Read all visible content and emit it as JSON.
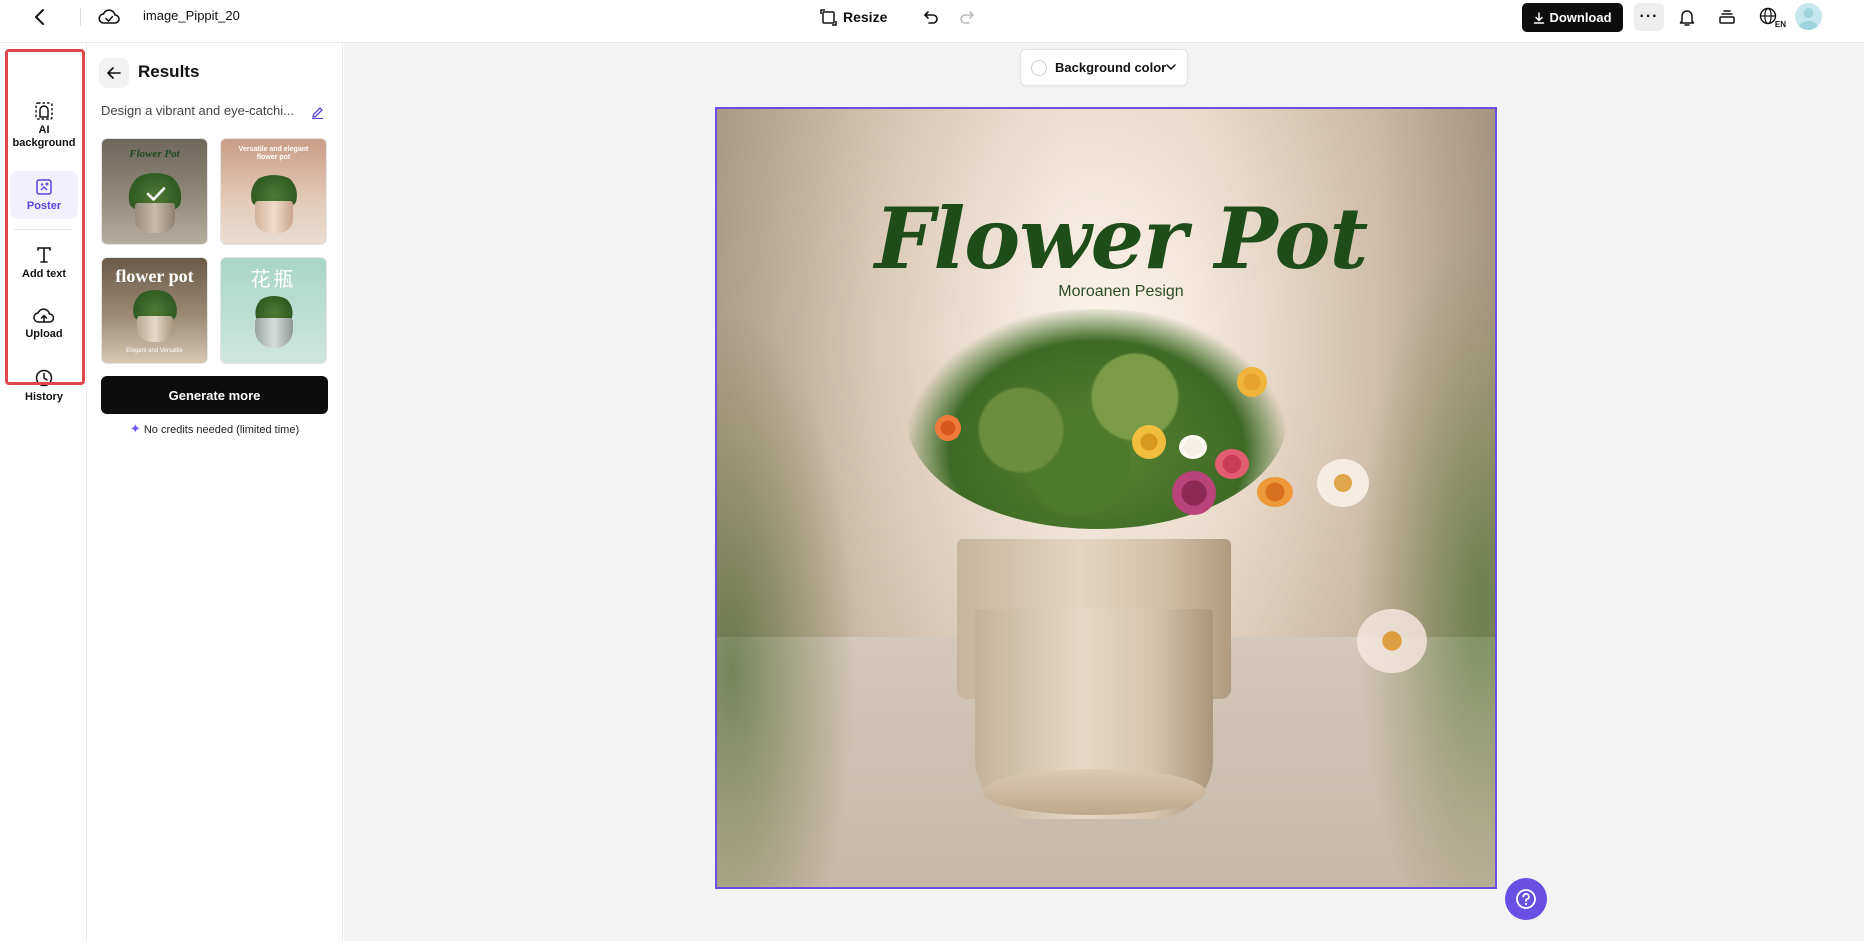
{
  "header": {
    "filename": "image_Pippit_20",
    "resize_label": "Resize",
    "download_label": "Download",
    "more_label": "···",
    "language_code": "EN"
  },
  "rail": {
    "items": [
      {
        "label": "AI background",
        "icon": "ai-background-icon"
      },
      {
        "label": "Poster",
        "icon": "poster-icon",
        "active": true
      },
      {
        "label": "Add text",
        "icon": "text-icon"
      },
      {
        "label": "Upload",
        "icon": "upload-cloud-icon"
      },
      {
        "label": "History",
        "icon": "clock-icon"
      }
    ]
  },
  "panel": {
    "title": "Results",
    "prompt": "Design a vibrant and eye-catchi...",
    "thumbnails": [
      {
        "text": "Flower Pot",
        "selected": true
      },
      {
        "text": "Versatile and elegant flower pot"
      },
      {
        "text": "flower pot",
        "sub": "Elegant and Versatile"
      },
      {
        "text": "花瓶"
      }
    ],
    "generate_label": "Generate more",
    "credits_label": "No credits needed (limited time)"
  },
  "canvas": {
    "background_color_label": "Background color",
    "poster_title": "Flower Pot",
    "poster_subtitle": "Moroanen Pesign"
  },
  "colors": {
    "accent": "#6a4fe4",
    "highlight": "#e0474c",
    "primary_button": "#0d0d0d",
    "poster_title": "#1f4d1a"
  }
}
